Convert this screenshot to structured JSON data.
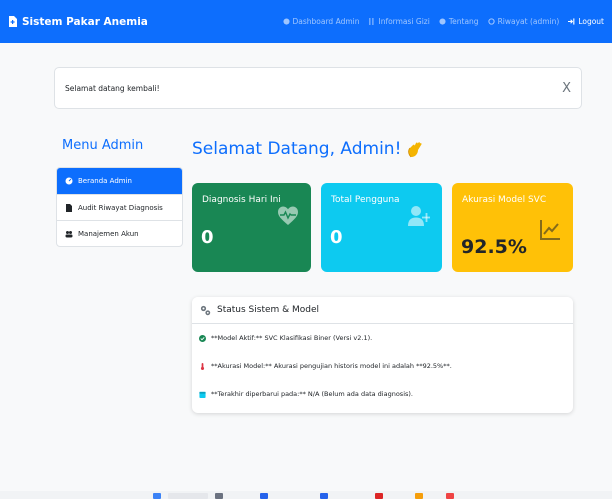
{
  "navbar": {
    "brand": "Sistem Pakar Anemia",
    "items": [
      {
        "label": "Dashboard Admin",
        "icon": "speedometer-icon"
      },
      {
        "label": "Informasi Gizi",
        "icon": "fork-knife-icon"
      },
      {
        "label": "Tentang",
        "icon": "info-icon"
      },
      {
        "label": "Riwayat (admin)",
        "icon": "history-icon"
      },
      {
        "label": "Logout",
        "icon": "logout-icon"
      }
    ]
  },
  "alert": {
    "message": "Selamat datang kembali!",
    "close": "X"
  },
  "sidebar": {
    "title": "Menu Admin",
    "items": [
      {
        "label": "Beranda Admin",
        "icon": "speedometer-icon",
        "active": true
      },
      {
        "label": "Audit Riwayat Diagnosis",
        "icon": "file-icon",
        "active": false
      },
      {
        "label": "Manajemen Akun",
        "icon": "users-icon",
        "active": false
      }
    ]
  },
  "main": {
    "welcome": "Selamat Datang, Admin!",
    "cards": [
      {
        "title": "Diagnosis Hari Ini",
        "value": "0",
        "icon": "heart-pulse-icon",
        "color": "#198754"
      },
      {
        "title": "Total Pengguna",
        "value": "0",
        "icon": "user-plus-icon",
        "color": "#0dcaf0"
      },
      {
        "title": "Akurasi Model SVC",
        "value": "92.5%",
        "icon": "chart-line-icon",
        "color": "#ffc107"
      }
    ],
    "status": {
      "title": "Status Sistem & Model",
      "rows": [
        {
          "text": "**Model Aktif:** SVC Klasifikasi Biner (Versi v2.1).",
          "icon": "check-circle-icon",
          "color": "#198754"
        },
        {
          "text": "**Akurasi Model:** Akurasi pengujian historis model ini adalah **92.5%**.",
          "icon": "thermometer-icon",
          "color": "#dc3545"
        },
        {
          "text": "**Terakhir diperbarui pada:** N/A (Belum ada data diagnosis).",
          "icon": "calendar-icon",
          "color": "#0dcaf0"
        }
      ]
    }
  },
  "colors": {
    "primary": "#0d6efd",
    "success": "#198754",
    "info": "#0dcaf0",
    "warning": "#ffc107"
  }
}
